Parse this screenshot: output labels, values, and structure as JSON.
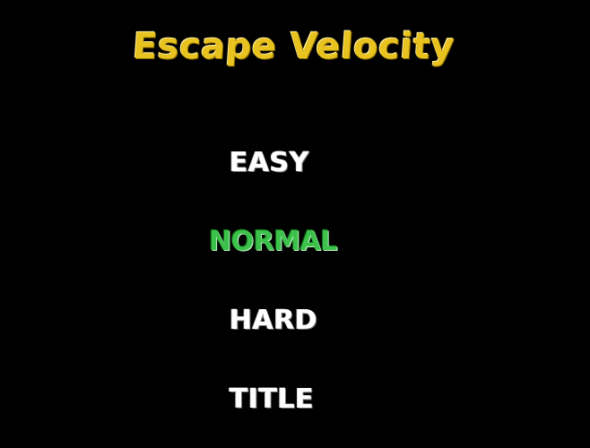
{
  "game": {
    "title": "Escape Velocity"
  },
  "menu": {
    "items": [
      {
        "label": "EASY",
        "selected": false
      },
      {
        "label": "NORMAL",
        "selected": true
      },
      {
        "label": "HARD",
        "selected": false
      },
      {
        "label": "TITLE",
        "selected": false
      }
    ]
  },
  "colors": {
    "background": "#000000",
    "title": "#e8c21f",
    "menu_item": "#ffffff",
    "menu_item_selected": "#3cc24a"
  }
}
